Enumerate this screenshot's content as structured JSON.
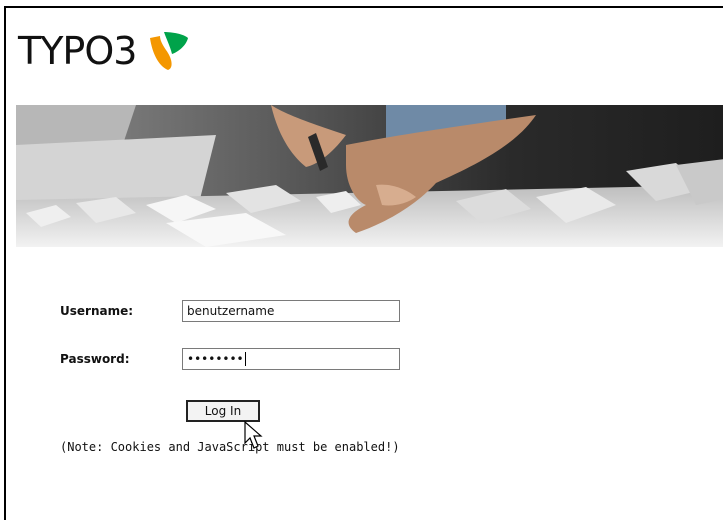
{
  "header": {
    "logo_text": "TYPO3",
    "logo_icon": "typo3-logo-icon",
    "logo_colors": [
      "#f49700",
      "#00a34a"
    ]
  },
  "banner": {
    "image": "architect-model-banner"
  },
  "login": {
    "username_label": "Username:",
    "username_value": "benutzername",
    "password_label": "Password:",
    "password_value": "••••••••",
    "submit_label": "Log In",
    "note": "(Note: Cookies and JavaScript must be enabled!)"
  }
}
